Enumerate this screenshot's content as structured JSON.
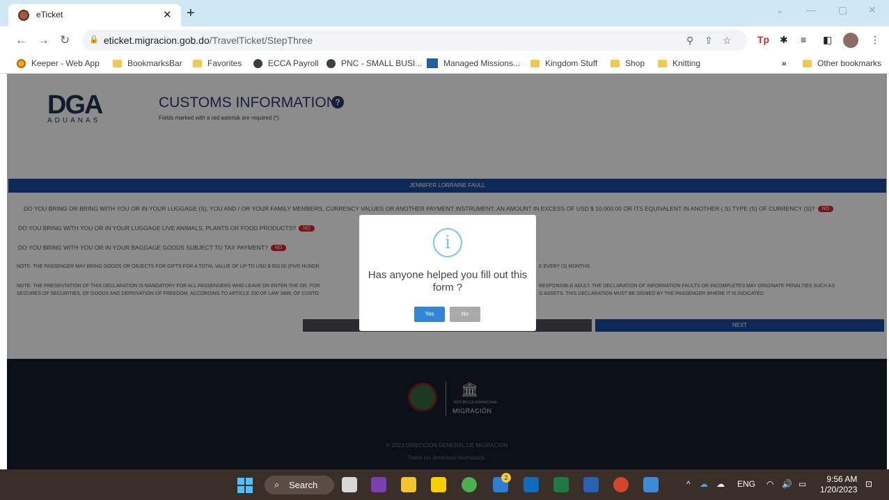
{
  "browser": {
    "tab_title": "eTicket",
    "tab_close": "✕",
    "new_tab": "+",
    "url_host": "eticket.migracion.gob.do",
    "url_path": "/TravelTicket/StepThree",
    "window_controls": [
      "minimize",
      "maximize",
      "close"
    ]
  },
  "bookmarks": {
    "items": [
      {
        "label": "Keeper - Web App",
        "icon": "keeper-icon"
      },
      {
        "label": "BookmarksBar",
        "icon": "folder-icon"
      },
      {
        "label": "Favorites",
        "icon": "folder-icon"
      },
      {
        "label": "ECCA Payroll",
        "icon": "globe-icon"
      },
      {
        "label": "PNC - SMALL BUSI...",
        "icon": "globe-icon"
      },
      {
        "label": "Managed Missions...",
        "icon": "managed-missions-icon"
      },
      {
        "label": "Kingdom Stuff",
        "icon": "folder-icon"
      },
      {
        "label": "Shop",
        "icon": "folder-icon"
      },
      {
        "label": "Knitting",
        "icon": "folder-icon"
      }
    ],
    "more": "»",
    "other": "Other bookmarks"
  },
  "page": {
    "logo_text": "DGA",
    "logo_sub": "ADUANAS",
    "title": "CUSTOMS INFORMATION",
    "required_note": "Fields marked with a red asterisk are required (*)",
    "passenger_name": "JENNIFER LORRAINE FAULL",
    "questions": [
      {
        "text": "DO YOU BRING OR BRING WITH YOU OR IN YOUR LUGGAGE (S), YOU AND / OR YOUR FAMILY MEMBERS, CURRENCY VALUES OR ANOTHER PAYMENT INSTRUMENT, AN AMOUNT IN EXCESS OF USD $ 10,000.00 OR ITS EQUIVALENT IN ANOTHER ( S) TYPE (S) OF CURRENCY (S)?",
        "answer": "NO"
      },
      {
        "text": "DO YOU BRING WITH YOU OR IN YOUR LUGGAGE LIVE ANIMALS, PLANTS OR FOOD PRODUCTS?",
        "answer": "NO"
      },
      {
        "text": "DO YOU BRING WITH YOU OR IN YOUR BAGGAGE GOODS SUBJECT TO TAX PAYMENT?",
        "answer": "NO"
      }
    ],
    "note1_left": "NOTE: THE PASSENGER MAY BRING GOODS OR OBJECTS FOR GIFTS FOR A TOTAL VALUE OF UP TO USD $ 500.00 (FIVE HUNDR",
    "note1_right": "E EVERY (3) MONTHS.",
    "note2_left_1": "NOTE: THE PRESENTATION OF THIS DECLARATION IS MANDATORY FOR ALL PASSENGERS WHO LEAVE OR ENTER THE DR. FOR",
    "note2_left_2": "SEIZURES OF SECURITIES, OF GOODS AND DEPRIVATION OF FREEDOM, ACCORDING TO ARTICLE 200 OF LAW 3489, OF CUSTO",
    "note2_right_1": "RESPONSIBLE ADULT. THE DECLARATION OF INFORMATION FAULTS OR INCOMPLETES MAY ORIGINATE PENALTIES SUCH AS",
    "note2_right_2": "G ASSETS. THIS DECLARATION MUST BE SIGNED BY THE PASSENGER WHERE IT IS INDICATED",
    "next_label": "NEXT",
    "footer_republic": "REPÚBLICA DOMINICANA",
    "footer_migracion": "MIGRACIÓN",
    "copyright": "© 2023 DIRECCION GENERAL DE MIGRACION",
    "rights": "Todos los derechos reservados."
  },
  "modal": {
    "icon": "i",
    "question": "Has anyone helped you fill out this form ?",
    "yes": "Yes",
    "no": "No"
  },
  "taskbar": {
    "search_label": "Search",
    "language": "ENG",
    "time": "9:56 AM",
    "date": "1/20/2023",
    "badge_count": "2"
  },
  "colors": {
    "brand_blue": "#1a4b9c",
    "no_badge": "#d9232e",
    "yes_button": "#3085d6",
    "tab_strip": "#cfe8f3"
  }
}
